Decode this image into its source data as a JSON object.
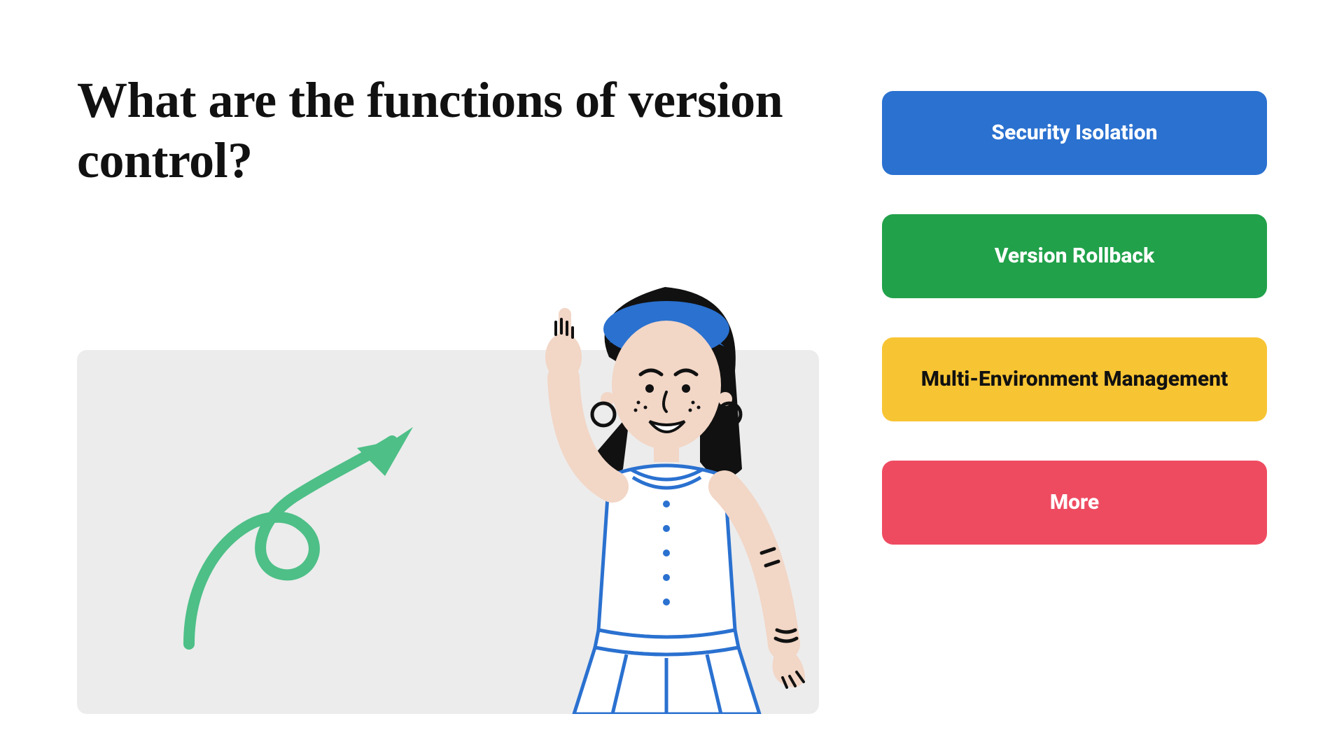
{
  "title": "What are the functions of version control?",
  "cards": [
    {
      "label": "Security Isolation",
      "slug": "security-isolation",
      "variant": "blue"
    },
    {
      "label": "Version Rollback",
      "slug": "version-rollback",
      "variant": "green"
    },
    {
      "label": "Multi-Environment Management",
      "slug": "multi-environment-management",
      "variant": "yellow"
    },
    {
      "label": "More",
      "slug": "more",
      "variant": "red"
    }
  ],
  "colors": {
    "blue": "#2a71d0",
    "green": "#21a14a",
    "yellow": "#f7c433",
    "red": "#ee4b61",
    "panel": "#ececec",
    "arrow": "#4dbf87"
  },
  "illustration": {
    "arrow_icon": "curly-arrow-icon",
    "person_icon": "pointing-woman-icon"
  }
}
